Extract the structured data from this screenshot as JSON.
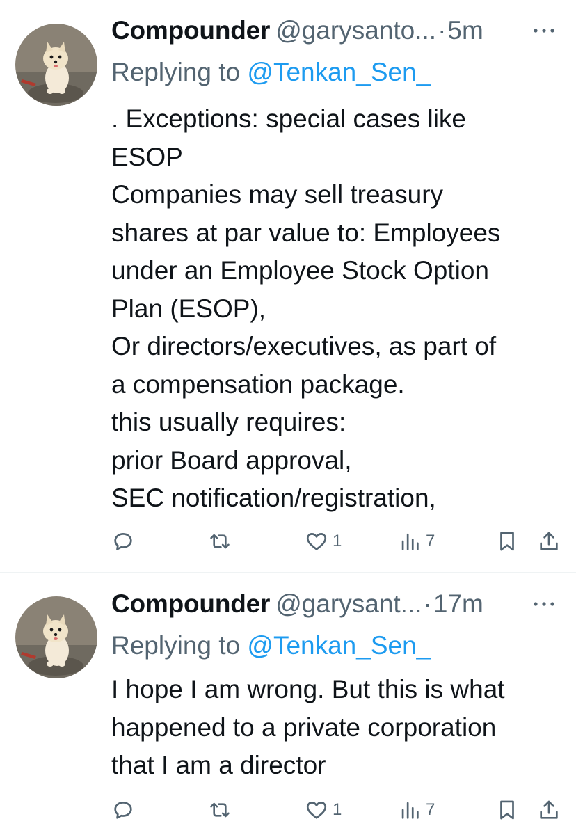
{
  "colors": {
    "text": "#0f1419",
    "secondary": "#536471",
    "link": "#1d9bf0",
    "divider": "#eff3f4"
  },
  "tweets": [
    {
      "display_name": "Compounder",
      "handle": "@garysanto...",
      "separator": "·",
      "time": "5m",
      "reply_prefix": "Replying to",
      "reply_to": "@Tenkan_Sen_",
      "lines": [
        ". Exceptions: special cases like",
        "ESOP",
        "Companies may sell treasury",
        "shares at par value to: Employees",
        "under an Employee Stock Option",
        "Plan (ESOP),",
        "Or directors/executives, as part of",
        "a compensation package.",
        "this usually requires:",
        "prior Board approval,",
        "SEC notification/registration,"
      ],
      "likes": "1",
      "views": "7",
      "icons": {
        "reply": "reply-icon",
        "retweet": "retweet-icon",
        "like": "heart-icon",
        "views": "views-icon",
        "bookmark": "bookmark-icon",
        "share": "share-icon",
        "more": "more-icon"
      }
    },
    {
      "display_name": "Compounder",
      "handle": "@garysant...",
      "separator": "·",
      "time": "17m",
      "reply_prefix": "Replying to",
      "reply_to": "@Tenkan_Sen_",
      "lines": [
        "I hope I am wrong. But this is what",
        "happened to a private corporation",
        "that I am a director"
      ],
      "likes": "1",
      "views": "7",
      "icons": {
        "reply": "reply-icon",
        "retweet": "retweet-icon",
        "like": "heart-icon",
        "views": "views-icon",
        "bookmark": "bookmark-icon",
        "share": "share-icon",
        "more": "more-icon"
      }
    }
  ]
}
